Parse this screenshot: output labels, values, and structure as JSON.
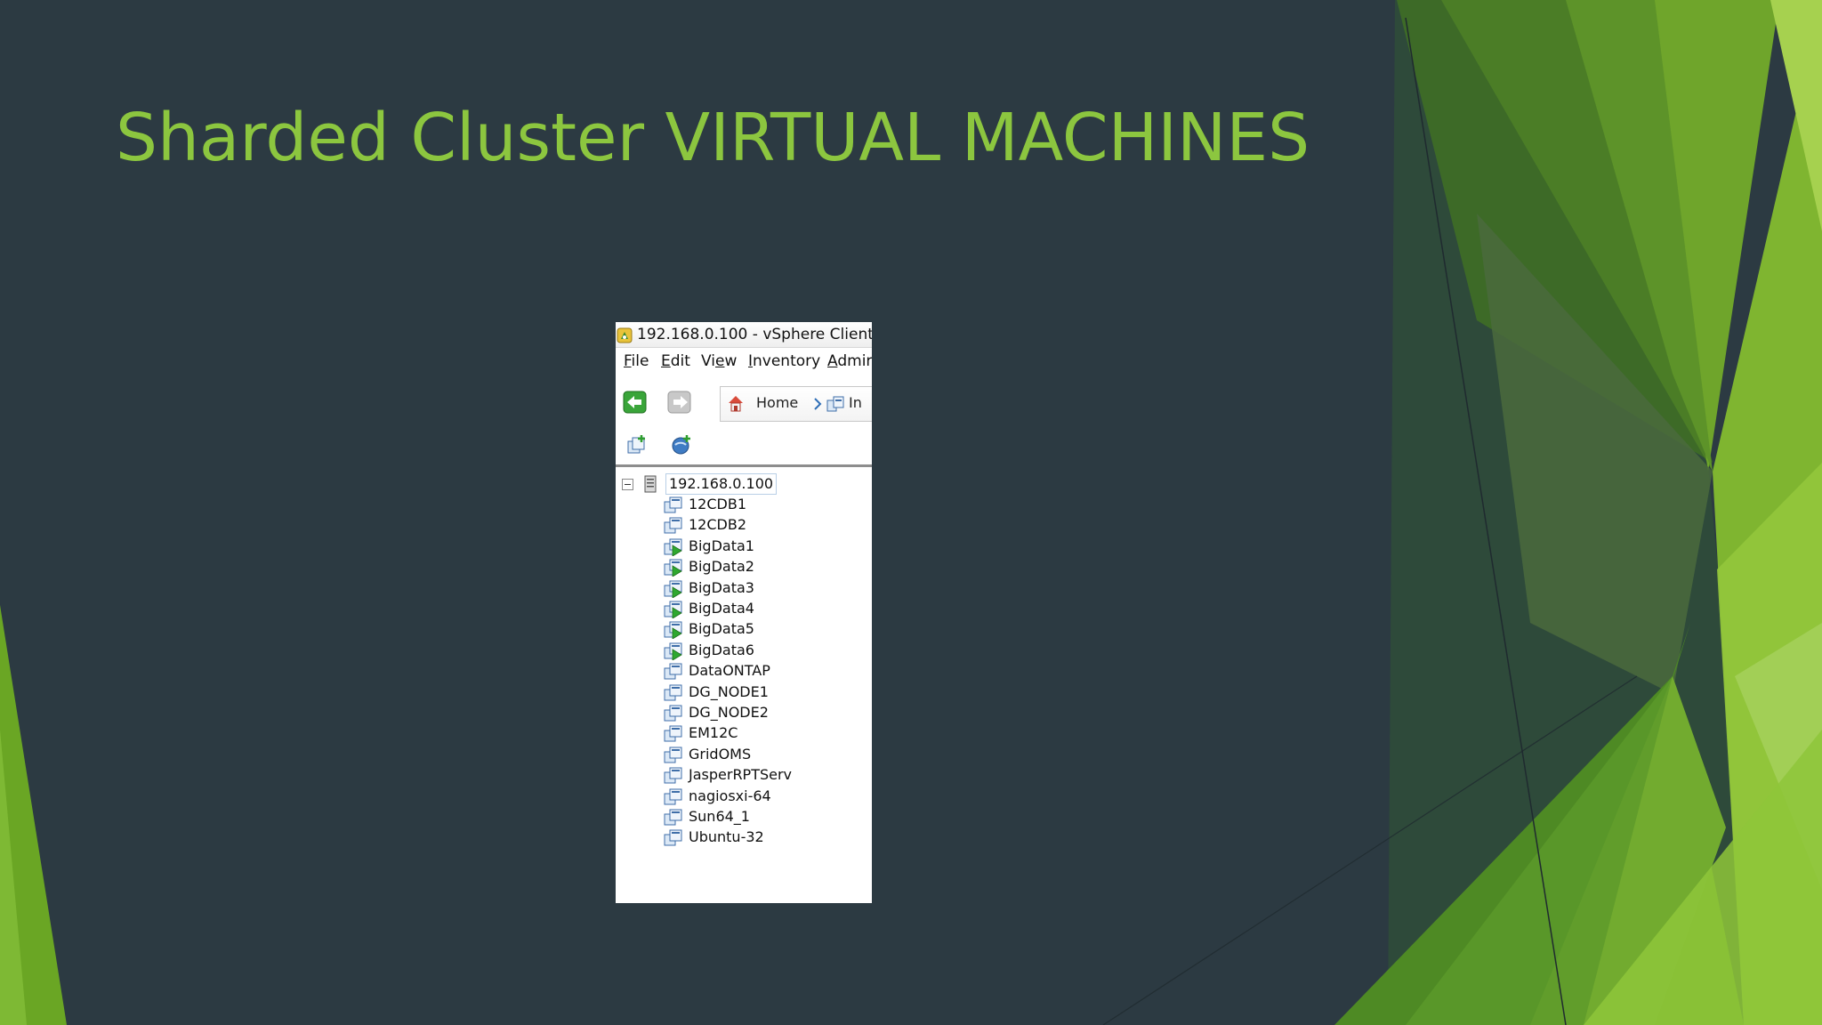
{
  "slide": {
    "title": "Sharded Cluster VIRTUAL MACHINES",
    "title_color": "#8cc63f",
    "background_color": "#2c3a42"
  },
  "window": {
    "title": "192.168.0.100 - vSphere Client",
    "app_icon": "vsphere-client-icon"
  },
  "menu": [
    {
      "pre": "",
      "accel": "F",
      "post": "ile"
    },
    {
      "pre": "",
      "accel": "E",
      "post": "dit"
    },
    {
      "pre": "Vi",
      "accel": "e",
      "post": "w"
    },
    {
      "pre": "",
      "accel": "I",
      "post": "nventory"
    },
    {
      "pre": "",
      "accel": "A",
      "post": "dmir"
    }
  ],
  "nav": {
    "back_icon": "back-arrow-icon",
    "forward_icon": "forward-arrow-icon",
    "breadcrumb": {
      "home": "Home",
      "inventory": "In"
    }
  },
  "toolbar": {
    "icons": [
      "new-vm-icon",
      "add-host-icon"
    ]
  },
  "tree": {
    "host": "192.168.0.100",
    "vms": [
      {
        "name": "12CDB1",
        "powered_on": false
      },
      {
        "name": "12CDB2",
        "powered_on": false
      },
      {
        "name": "BigData1",
        "powered_on": true
      },
      {
        "name": "BigData2",
        "powered_on": true
      },
      {
        "name": "BigData3",
        "powered_on": true
      },
      {
        "name": "BigData4",
        "powered_on": true
      },
      {
        "name": "BigData5",
        "powered_on": true
      },
      {
        "name": "BigData6",
        "powered_on": true
      },
      {
        "name": "DataONTAP",
        "powered_on": false
      },
      {
        "name": "DG_NODE1",
        "powered_on": false
      },
      {
        "name": "DG_NODE2",
        "powered_on": false
      },
      {
        "name": "EM12C",
        "powered_on": false
      },
      {
        "name": "GridOMS",
        "powered_on": false
      },
      {
        "name": "JasperRPTServ",
        "powered_on": false
      },
      {
        "name": "nagiosxi-64",
        "powered_on": false
      },
      {
        "name": "Sun64_1",
        "powered_on": false
      },
      {
        "name": "Ubuntu-32",
        "powered_on": false
      }
    ]
  }
}
